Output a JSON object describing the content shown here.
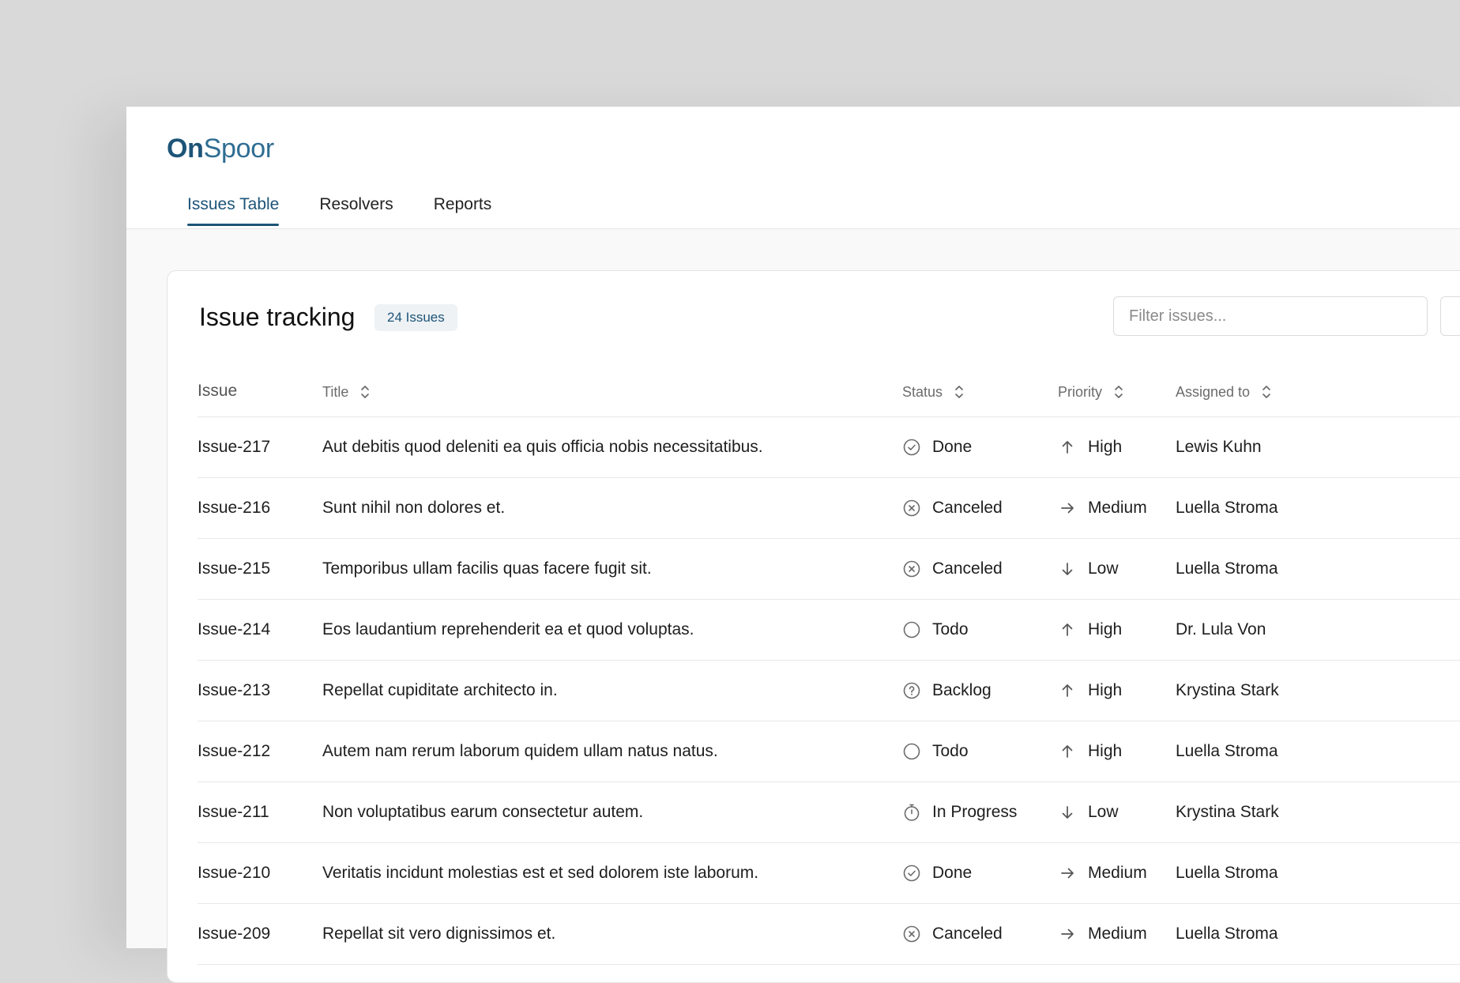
{
  "brand": {
    "bold": "On",
    "light": "Spoor"
  },
  "tabs": [
    {
      "label": "Issues Table",
      "active": true
    },
    {
      "label": "Resolvers",
      "active": false
    },
    {
      "label": "Reports",
      "active": false
    }
  ],
  "card": {
    "title": "Issue tracking",
    "count_badge": "24 Issues",
    "filter_placeholder": "Filter issues..."
  },
  "table": {
    "columns": {
      "issue": "Issue",
      "title": "Title",
      "status": "Status",
      "priority": "Priority",
      "assigned": "Assigned to"
    },
    "rows": [
      {
        "id": "Issue-217",
        "title": "Aut debitis quod deleniti ea quis officia nobis necessitatibus.",
        "status": "Done",
        "status_icon": "check-circle-icon",
        "priority": "High",
        "priority_icon": "arrow-up-icon",
        "assignee": "Lewis Kuhn"
      },
      {
        "id": "Issue-216",
        "title": "Sunt nihil non dolores et.",
        "status": "Canceled",
        "status_icon": "x-circle-icon",
        "priority": "Medium",
        "priority_icon": "arrow-right-icon",
        "assignee": "Luella Stroma"
      },
      {
        "id": "Issue-215",
        "title": "Temporibus ullam facilis quas facere fugit sit.",
        "status": "Canceled",
        "status_icon": "x-circle-icon",
        "priority": "Low",
        "priority_icon": "arrow-down-icon",
        "assignee": "Luella Stroma"
      },
      {
        "id": "Issue-214",
        "title": "Eos laudantium reprehenderit ea et quod voluptas.",
        "status": "Todo",
        "status_icon": "circle-icon",
        "priority": "High",
        "priority_icon": "arrow-up-icon",
        "assignee": "Dr. Lula Von"
      },
      {
        "id": "Issue-213",
        "title": "Repellat cupiditate architecto in.",
        "status": "Backlog",
        "status_icon": "question-circle-icon",
        "priority": "High",
        "priority_icon": "arrow-up-icon",
        "assignee": "Krystina Stark"
      },
      {
        "id": "Issue-212",
        "title": "Autem nam rerum laborum quidem ullam natus natus.",
        "status": "Todo",
        "status_icon": "circle-icon",
        "priority": "High",
        "priority_icon": "arrow-up-icon",
        "assignee": "Luella Stroma"
      },
      {
        "id": "Issue-211",
        "title": "Non voluptatibus earum consectetur autem.",
        "status": "In Progress",
        "status_icon": "stopwatch-icon",
        "priority": "Low",
        "priority_icon": "arrow-down-icon",
        "assignee": "Krystina Stark"
      },
      {
        "id": "Issue-210",
        "title": "Veritatis incidunt molestias est et sed dolorem iste laborum.",
        "status": "Done",
        "status_icon": "check-circle-icon",
        "priority": "Medium",
        "priority_icon": "arrow-right-icon",
        "assignee": "Luella Stroma"
      },
      {
        "id": "Issue-209",
        "title": "Repellat sit vero dignissimos et.",
        "status": "Canceled",
        "status_icon": "x-circle-icon",
        "priority": "Medium",
        "priority_icon": "arrow-right-icon",
        "assignee": "Luella Stroma"
      }
    ]
  },
  "colors": {
    "accent": "#1d5478",
    "background": "#d9d9d9",
    "card": "#ffffff"
  }
}
